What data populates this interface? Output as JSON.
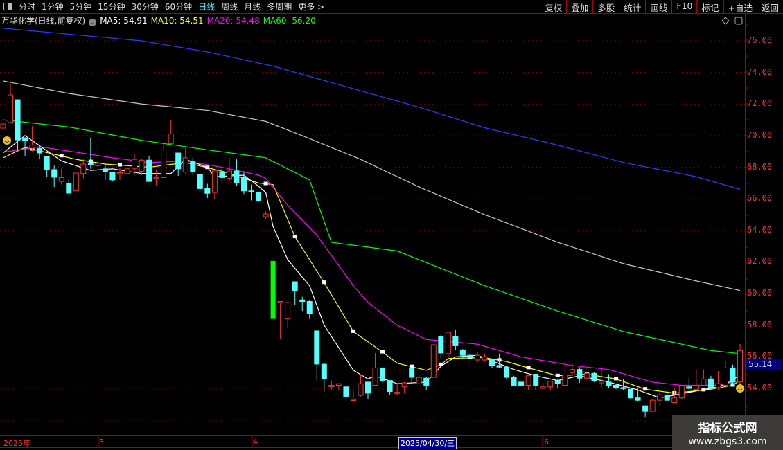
{
  "toolbar": {
    "periods": [
      "分时",
      "1分钟",
      "5分钟",
      "15分钟",
      "30分钟",
      "60分钟",
      "日线",
      "周线",
      "月线",
      "多周期",
      "更多 >"
    ],
    "active_period": "日线",
    "buttons": [
      "复权",
      "叠加",
      "多股",
      "统计",
      "画线",
      "F10",
      "标记",
      "+自选",
      "返回"
    ]
  },
  "info": {
    "title": "万华化学(日线,前复权)",
    "ma5": "MA5: 54.91",
    "ma10": "MA10: 54.51",
    "ma20": "MA20: 54.48",
    "ma60": "MA60: 56.20"
  },
  "current_price": "55.14",
  "date_axis": {
    "labels": [
      "2025年",
      "3",
      "4",
      "6"
    ],
    "highlight": "2025/04/30/三"
  },
  "watermark": {
    "line1": "指标公式网",
    "line2": "www.zbgs3.com"
  },
  "colors": {
    "up": "#ff3232",
    "down": "#54ffff",
    "ma5": "#ffffff",
    "ma10": "#ffff00",
    "ma20": "#ff00ff",
    "ma60": "#00ff00",
    "ma_gray": "#c8c8c8",
    "ma_blue": "#2a3cff",
    "axis": "#ff3232",
    "border": "#b00000"
  },
  "chart_data": {
    "type": "candlestick",
    "title": "万华化学(日线,前复权)",
    "ylim": [
      52,
      77
    ],
    "yticks": [
      "76.00",
      "74.00",
      "72.00",
      "70.00",
      "68.00",
      "66.00",
      "64.00",
      "62.00",
      "60.00",
      "58.00",
      "56.00",
      "54.00"
    ],
    "ohlc": [
      [
        70.48,
        71.0,
        70.0,
        70.74
      ],
      [
        70.83,
        73.24,
        70.8,
        72.58
      ],
      [
        72.27,
        72.3,
        69.1,
        69.73
      ],
      [
        69.8,
        69.9,
        68.7,
        69.7
      ],
      [
        69.2,
        70.6,
        69.0,
        69.4
      ],
      [
        69.2,
        69.3,
        68.5,
        68.9
      ],
      [
        68.7,
        68.7,
        67.4,
        67.85
      ],
      [
        67.85,
        68.1,
        66.75,
        67.37
      ],
      [
        67.1,
        67.9,
        66.9,
        67.35
      ],
      [
        66.97,
        67.23,
        66.2,
        66.36
      ],
      [
        66.5,
        67.65,
        66.5,
        67.63
      ],
      [
        67.6,
        68.5,
        67.3,
        68.2
      ],
      [
        68.25,
        69.87,
        67.9,
        68.15
      ],
      [
        68.1,
        69.4,
        68.0,
        68.25
      ],
      [
        67.9,
        68.2,
        67.2,
        67.7
      ],
      [
        67.68,
        67.7,
        67.1,
        67.2
      ],
      [
        67.6,
        67.98,
        67.2,
        67.65
      ],
      [
        67.6,
        68.5,
        67.3,
        67.9
      ],
      [
        67.9,
        68.85,
        67.5,
        68.5
      ],
      [
        67.75,
        68.5,
        67.5,
        68.45
      ],
      [
        68.45,
        68.7,
        67.1,
        67.1
      ],
      [
        67.3,
        67.8,
        66.85,
        67.35
      ],
      [
        67.35,
        69.5,
        67.3,
        69.1
      ],
      [
        69.5,
        71.0,
        69.5,
        70.1
      ],
      [
        68.9,
        68.9,
        67.45,
        67.9
      ],
      [
        67.7,
        69.2,
        67.6,
        68.6
      ],
      [
        68.35,
        68.6,
        67.5,
        67.7
      ],
      [
        67.55,
        67.6,
        66.6,
        66.65
      ],
      [
        66.65,
        66.95,
        66.05,
        66.35
      ],
      [
        66.4,
        67.8,
        65.97,
        67.76
      ],
      [
        67.7,
        68.05,
        67.0,
        67.35
      ],
      [
        67.3,
        68.6,
        67.1,
        67.76
      ],
      [
        67.76,
        68.5,
        66.8,
        67.0
      ],
      [
        67.35,
        67.75,
        66.3,
        66.5
      ],
      [
        66.5,
        66.9,
        65.9,
        66.45
      ],
      [
        66.4,
        66.4,
        65.8,
        65.9
      ],
      [
        64.87,
        65.2,
        64.7,
        65.04
      ],
      [
        62.07,
        62.07,
        58.4,
        58.4
      ],
      [
        59.45,
        59.5,
        57.15,
        59.5
      ],
      [
        58.4,
        59.45,
        57.8,
        59.43
      ],
      [
        60.75,
        60.75,
        59.3,
        60.18
      ],
      [
        59.6,
        59.8,
        58.9,
        59.5
      ],
      [
        59.5,
        59.6,
        58.4,
        58.73
      ],
      [
        57.64,
        57.64,
        54.5,
        55.54
      ],
      [
        55.53,
        55.6,
        53.8,
        54.6
      ],
      [
        54.1,
        54.5,
        53.9,
        54.2
      ],
      [
        54.2,
        54.3,
        53.9,
        54.3
      ],
      [
        54.1,
        54.1,
        53.17,
        53.5
      ],
      [
        53.25,
        53.9,
        53.2,
        53.3
      ],
      [
        53.56,
        54.9,
        53.5,
        54.3
      ],
      [
        54.4,
        54.4,
        53.3,
        53.7
      ],
      [
        54.2,
        56.24,
        54.2,
        55.3
      ],
      [
        55.3,
        55.3,
        54.4,
        54.5
      ],
      [
        54.5,
        54.5,
        53.6,
        53.8
      ],
      [
        53.7,
        54.3,
        53.6,
        53.75
      ],
      [
        54.1,
        54.4,
        53.7,
        54.35
      ],
      [
        55.3,
        55.3,
        54.3,
        54.7
      ],
      [
        54.3,
        54.9,
        54.2,
        54.7
      ],
      [
        54.65,
        54.7,
        53.9,
        54.2
      ],
      [
        54.7,
        56.8,
        54.7,
        56.76
      ],
      [
        57.3,
        57.4,
        55.9,
        56.24
      ],
      [
        56.2,
        57.55,
        55.9,
        57.55
      ],
      [
        57.3,
        57.7,
        56.4,
        56.7
      ],
      [
        56.4,
        56.5,
        55.9,
        56.1
      ],
      [
        56.1,
        56.2,
        55.4,
        55.95
      ],
      [
        55.8,
        56.3,
        55.6,
        56.1
      ],
      [
        55.8,
        56.2,
        55.7,
        56.0
      ],
      [
        55.85,
        55.85,
        55.3,
        55.45
      ],
      [
        55.45,
        56.2,
        55.3,
        55.35
      ],
      [
        55.35,
        55.4,
        54.6,
        54.7
      ],
      [
        54.7,
        54.8,
        54.15,
        54.2
      ],
      [
        54.4,
        54.4,
        54.15,
        54.2
      ],
      [
        54.2,
        54.8,
        53.9,
        54.8
      ],
      [
        54.9,
        54.9,
        53.9,
        54.2
      ],
      [
        54.0,
        54.4,
        53.9,
        54.1
      ],
      [
        54.1,
        54.5,
        53.9,
        54.45
      ],
      [
        54.5,
        54.6,
        54.0,
        54.3
      ],
      [
        54.2,
        55.75,
        54.15,
        54.85
      ],
      [
        55.0,
        55.6,
        54.8,
        55.2
      ],
      [
        55.2,
        55.35,
        54.35,
        54.65
      ],
      [
        54.65,
        55.05,
        54.6,
        54.95
      ],
      [
        54.95,
        55.05,
        54.4,
        54.5
      ],
      [
        54.35,
        55.3,
        54.0,
        54.45
      ],
      [
        54.4,
        54.9,
        54.0,
        54.2
      ],
      [
        54.2,
        54.3,
        53.95,
        54.05
      ],
      [
        54.05,
        54.6,
        53.9,
        54.0
      ],
      [
        53.95,
        53.95,
        53.3,
        53.4
      ],
      [
        53.4,
        54.0,
        53.2,
        53.25
      ],
      [
        52.9,
        52.9,
        52.2,
        52.55
      ],
      [
        52.55,
        53.3,
        52.55,
        53.25
      ],
      [
        53.25,
        53.95,
        52.85,
        53.6
      ],
      [
        53.55,
        53.9,
        53.2,
        53.25
      ],
      [
        53.1,
        54.0,
        53.05,
        53.4
      ],
      [
        53.4,
        54.2,
        53.3,
        54.2
      ],
      [
        54.1,
        54.7,
        53.9,
        54.0
      ],
      [
        53.95,
        55.2,
        53.8,
        54.2
      ],
      [
        54.2,
        55.2,
        54.15,
        54.6
      ],
      [
        54.6,
        54.8,
        53.9,
        54.05
      ],
      [
        54.05,
        55.1,
        53.9,
        54.3
      ],
      [
        54.2,
        55.75,
        54.15,
        55.3
      ],
      [
        55.3,
        55.5,
        54.2,
        54.4
      ],
      [
        54.4,
        56.8,
        54.2,
        56.4
      ]
    ],
    "highlight_bar_index": 37,
    "ma_series": [
      {
        "name": "MA5",
        "color": "#ffffff",
        "points": [
          [
            0,
            68.9
          ],
          [
            3,
            70.0
          ],
          [
            8,
            68.4
          ],
          [
            12,
            67.8
          ],
          [
            15,
            67.9
          ],
          [
            19,
            67.6
          ],
          [
            23,
            67.6
          ],
          [
            25,
            68.5
          ],
          [
            28,
            68.0
          ],
          [
            29,
            67.4
          ],
          [
            33,
            67.5
          ],
          [
            35,
            66.8
          ],
          [
            36,
            66.4
          ],
          [
            37,
            64.25
          ],
          [
            39,
            62.15
          ],
          [
            42,
            60.5
          ],
          [
            44,
            58.0
          ],
          [
            48,
            55.15
          ],
          [
            50,
            54.6
          ],
          [
            51,
            54.8
          ],
          [
            54,
            54.3
          ],
          [
            58,
            54.4
          ],
          [
            60,
            55.4
          ],
          [
            62,
            56.0
          ],
          [
            65,
            56.1
          ],
          [
            70,
            55.2
          ],
          [
            73,
            54.8
          ],
          [
            76,
            54.5
          ],
          [
            79,
            54.8
          ],
          [
            83,
            54.4
          ],
          [
            87,
            53.9
          ],
          [
            90,
            53.4
          ],
          [
            94,
            53.75
          ],
          [
            98,
            54.1
          ],
          [
            100,
            54.5
          ],
          [
            101,
            54.91
          ]
        ]
      },
      {
        "name": "MA10",
        "color": "#ffff00",
        "points": [
          [
            0,
            68.6
          ],
          [
            3,
            69.25
          ],
          [
            10,
            68.5
          ],
          [
            14,
            68.2
          ],
          [
            20,
            68.0
          ],
          [
            25,
            68.3
          ],
          [
            30,
            67.75
          ],
          [
            35,
            67.0
          ],
          [
            37,
            66.9
          ],
          [
            40,
            63.6
          ],
          [
            44,
            60.7
          ],
          [
            48,
            57.6
          ],
          [
            52,
            56.3
          ],
          [
            54,
            55.6
          ],
          [
            58,
            55.15
          ],
          [
            60,
            55.5
          ],
          [
            61,
            55.9
          ],
          [
            66,
            55.95
          ],
          [
            69,
            55.7
          ],
          [
            72,
            55.3
          ],
          [
            76,
            54.8
          ],
          [
            80,
            54.9
          ],
          [
            84,
            54.6
          ],
          [
            88,
            53.95
          ],
          [
            92,
            53.7
          ],
          [
            97,
            53.95
          ],
          [
            100,
            54.2
          ],
          [
            101,
            54.51
          ]
        ]
      },
      {
        "name": "MA20",
        "color": "#ff00ff",
        "points": [
          [
            0,
            68.95
          ],
          [
            5,
            69.3
          ],
          [
            10,
            68.95
          ],
          [
            15,
            68.6
          ],
          [
            20,
            68.3
          ],
          [
            25,
            68.4
          ],
          [
            30,
            68.0
          ],
          [
            35,
            67.5
          ],
          [
            36,
            67.3
          ],
          [
            39,
            65.6
          ],
          [
            43,
            63.7
          ],
          [
            48,
            60.5
          ],
          [
            50,
            59.45
          ],
          [
            54,
            58.0
          ],
          [
            58,
            57.1
          ],
          [
            65,
            56.8
          ],
          [
            71,
            56.0
          ],
          [
            78,
            55.45
          ],
          [
            83,
            55.2
          ],
          [
            89,
            54.4
          ],
          [
            93,
            54.2
          ],
          [
            98,
            54.2
          ],
          [
            101,
            54.48
          ]
        ]
      },
      {
        "name": "MA60",
        "color": "#00ff00",
        "points": [
          [
            0,
            71.0
          ],
          [
            9,
            70.55
          ],
          [
            19,
            69.7
          ],
          [
            28,
            69.1
          ],
          [
            36,
            68.6
          ],
          [
            42,
            67.2
          ],
          [
            45,
            63.25
          ],
          [
            54,
            62.7
          ],
          [
            66,
            60.5
          ],
          [
            76,
            58.9
          ],
          [
            85,
            57.6
          ],
          [
            97,
            56.4
          ],
          [
            101,
            56.2
          ]
        ]
      },
      {
        "name": "MA-gray",
        "color": "#c8c8c8",
        "points": [
          [
            0,
            73.46
          ],
          [
            9,
            72.67
          ],
          [
            19,
            72.0
          ],
          [
            28,
            71.6
          ],
          [
            36,
            70.9
          ],
          [
            41,
            70.0
          ],
          [
            49,
            68.5
          ],
          [
            57,
            66.75
          ],
          [
            66,
            65.0
          ],
          [
            76,
            63.25
          ],
          [
            85,
            61.9
          ],
          [
            95,
            60.8
          ],
          [
            101,
            60.2
          ]
        ]
      },
      {
        "name": "MA-blue",
        "color": "#2a3cff",
        "points": [
          [
            0,
            76.8
          ],
          [
            19,
            76.0
          ],
          [
            28,
            75.3
          ],
          [
            37,
            74.4
          ],
          [
            47,
            73.1
          ],
          [
            57,
            71.8
          ],
          [
            66,
            70.5
          ],
          [
            76,
            69.4
          ],
          [
            85,
            68.3
          ],
          [
            95,
            67.4
          ],
          [
            101,
            66.6
          ]
        ]
      }
    ]
  }
}
